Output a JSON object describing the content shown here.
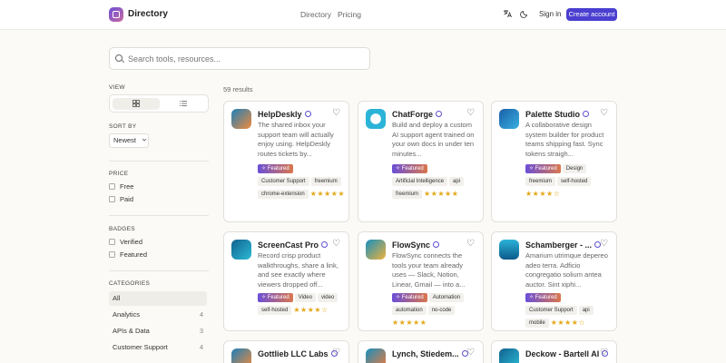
{
  "header": {
    "brand": "Directory",
    "nav": [
      "Directory",
      "Pricing"
    ],
    "translate_icon": "translate-icon",
    "theme_icon": "moon-icon",
    "sign_in": "Sign in",
    "create_account": "Create account"
  },
  "search": {
    "placeholder": "Search tools, resources..."
  },
  "sidebar": {
    "view_title": "VIEW",
    "view_grid_icon": "grid-icon",
    "view_list_icon": "list-icon",
    "sort_title": "SORT BY",
    "sort_value": "Newest",
    "price_title": "PRICE",
    "price_options": [
      "Free",
      "Paid"
    ],
    "badges_title": "BADGES",
    "badge_options": [
      "Verified",
      "Featured"
    ],
    "categories_title": "CATEGORIES",
    "categories": [
      {
        "label": "All",
        "count": ""
      },
      {
        "label": "Analytics",
        "count": "4"
      },
      {
        "label": "APIs & Data",
        "count": "3"
      },
      {
        "label": "Customer Support",
        "count": "4"
      }
    ]
  },
  "results": {
    "count_text": "59 results"
  },
  "cards": [
    {
      "name": "HelpDeskly",
      "desc": "The shared inbox your support team will actually enjoy using. HelpDeskly routes tickets by...",
      "featured": "Featured",
      "tags": [
        "Customer Support",
        "freemium",
        "chrome-extension"
      ],
      "rating": 5
    },
    {
      "name": "ChatForge",
      "desc": "Build and deploy a custom AI support agent trained on your own docs in under ten minutes...",
      "featured": "Featured",
      "tags": [
        "Artificial Intelligence",
        "api",
        "freemium"
      ],
      "rating": 5
    },
    {
      "name": "Palette Studio",
      "desc": "A collaborative design system builder for product teams shipping fast. Sync tokens straigh...",
      "featured": "Featured",
      "tags": [
        "Design",
        "freemium",
        "self-hosted"
      ],
      "rating": 4
    },
    {
      "name": "ScreenCast Pro",
      "desc": "Record crisp product walkthroughs, share a link, and see exactly where viewers dropped off...",
      "featured": "Featured",
      "tags": [
        "Video",
        "video",
        "self-hosted"
      ],
      "rating": 4
    },
    {
      "name": "FlowSync",
      "desc": "FlowSync connects the tools your team already uses — Slack, Notion, Linear, Gmail — into a...",
      "featured": "Featured",
      "tags": [
        "Automation",
        "automation",
        "no-code"
      ],
      "rating": 5
    },
    {
      "name": "Schamberger - ...",
      "desc": "Amarium utrimque depereo adeo terra. Adficio congregatio solium antea auctor. Sint xiphi...",
      "featured": "Featured",
      "tags": [
        "Customer Support",
        "api",
        "mobile"
      ],
      "rating": 4
    },
    {
      "name": "Gottlieb LLC Labs",
      "desc": "",
      "featured": "",
      "tags": [],
      "rating": 0
    },
    {
      "name": "Lynch, Stiedem...",
      "desc": "",
      "featured": "",
      "tags": [],
      "rating": 0
    },
    {
      "name": "Deckow - Bartell AI",
      "desc": "",
      "featured": "",
      "tags": [],
      "rating": 0
    }
  ],
  "colors": {
    "accent": "#4a3fd0",
    "star": "#e3a81a",
    "featured_from": "#6b4fd8",
    "featured_to": "#d9774d"
  }
}
